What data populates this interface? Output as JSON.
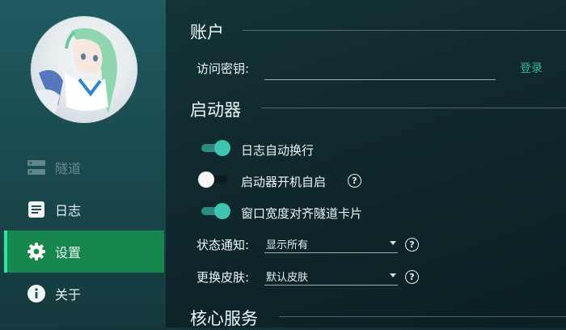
{
  "sidebar": {
    "items": [
      {
        "label": "隧道",
        "icon": "server-icon",
        "state": "disabled"
      },
      {
        "label": "日志",
        "icon": "log-icon",
        "state": "normal"
      },
      {
        "label": "设置",
        "icon": "gear-icon",
        "state": "active"
      },
      {
        "label": "关于",
        "icon": "info-icon",
        "state": "normal"
      }
    ],
    "active_color": "#17864f"
  },
  "account": {
    "title": "账户",
    "access_key_label": "访问密钥:",
    "access_key_value": "",
    "login_label": "登录"
  },
  "launcher": {
    "title": "启动器",
    "toggles": [
      {
        "label": "日志自动换行",
        "on": true
      },
      {
        "label": "启动器开机自启",
        "on": false,
        "help": "?"
      },
      {
        "label": "窗口宽度对齐隧道卡片",
        "on": true
      }
    ],
    "notify_label": "状态通知:",
    "notify_value": "显示所有",
    "notify_help": "?",
    "skin_label": "更换皮肤:",
    "skin_value": "默认皮肤",
    "skin_help": "?"
  },
  "core": {
    "title": "核心服务"
  },
  "colors": {
    "accent": "#2fb89a",
    "switch_on": "#3fc4b1"
  }
}
